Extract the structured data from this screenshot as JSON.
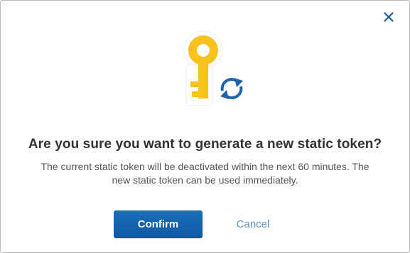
{
  "dialog": {
    "title": "Are you sure you want to generate a new static token?",
    "message_line1": "The current static token will be deactivated within the next 60 minutes. The",
    "message_line2": "new static token can be used immediately.",
    "confirm_label": "Confirm",
    "cancel_label": "Cancel",
    "close_icon": "close-icon",
    "illustration_icons": [
      "key-icon",
      "refresh-icon"
    ]
  },
  "colors": {
    "key": "#f7c21b",
    "refresh": "#1f64a8",
    "primary_button": "#135fa9",
    "cancel_link": "#5b93c4",
    "close": "#1f5e99"
  }
}
